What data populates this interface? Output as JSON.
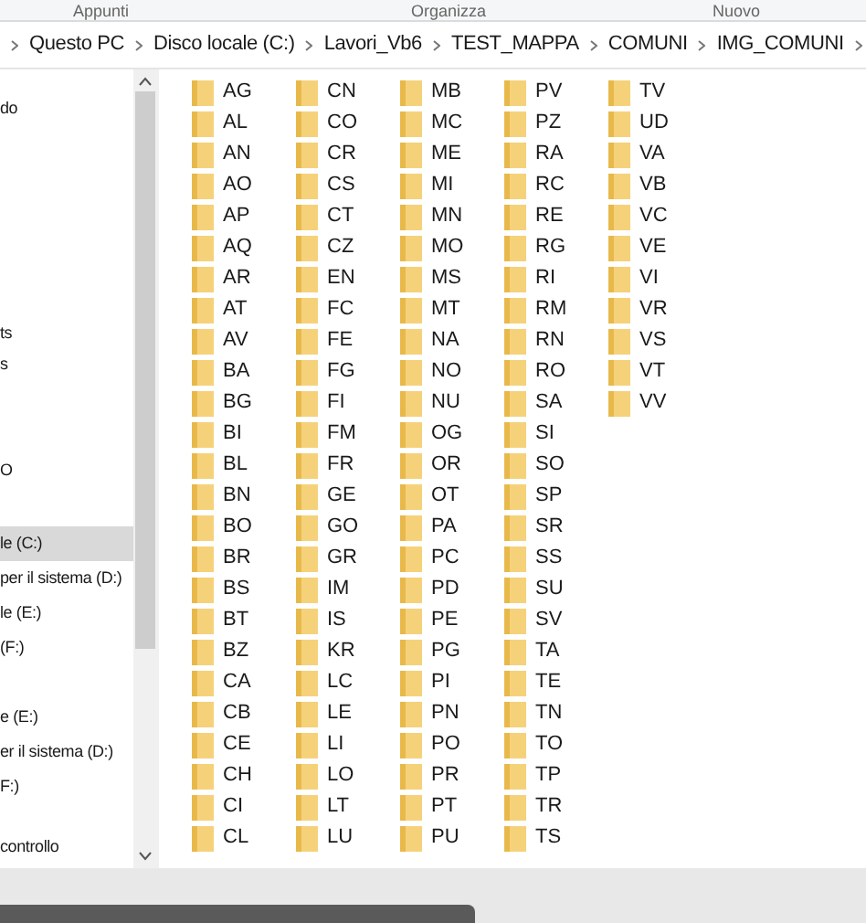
{
  "ribbon_groups": [
    "Appunti",
    "Organizza",
    "Nuovo"
  ],
  "breadcrumb": [
    "Questo PC",
    "Disco locale (C:)",
    "Lavori_Vb6",
    "TEST_MAPPA",
    "COMUNI",
    "IMG_COMUNI"
  ],
  "sidebar": {
    "items": [
      {
        "label": "do",
        "selected": false
      },
      {
        "label": "ts",
        "selected": false
      },
      {
        "label": "s",
        "selected": false
      },
      {
        "label": "O",
        "selected": false
      },
      {
        "label": "le (C:)",
        "selected": true
      },
      {
        "label": "per il sistema (D:)",
        "selected": false
      },
      {
        "label": "le (E:)",
        "selected": false
      },
      {
        "label": "(F:)",
        "selected": false
      },
      {
        "label": "e (E:)",
        "selected": false
      },
      {
        "label": "er il sistema (D:)",
        "selected": false
      },
      {
        "label": "F:)",
        "selected": false
      },
      {
        "label": "controllo",
        "selected": false
      }
    ]
  },
  "folders": [
    [
      "AG",
      "AL",
      "AN",
      "AO",
      "AP",
      "AQ",
      "AR",
      "AT",
      "AV",
      "BA",
      "BG",
      "BI",
      "BL",
      "BN",
      "BO",
      "BR",
      "BS",
      "BT",
      "BZ",
      "CA",
      "CB",
      "CE",
      "CH",
      "CI",
      "CL"
    ],
    [
      "CN",
      "CO",
      "CR",
      "CS",
      "CT",
      "CZ",
      "EN",
      "FC",
      "FE",
      "FG",
      "FI",
      "FM",
      "FR",
      "GE",
      "GO",
      "GR",
      "IM",
      "IS",
      "KR",
      "LC",
      "LE",
      "LI",
      "LO",
      "LT",
      "LU"
    ],
    [
      "MB",
      "MC",
      "ME",
      "MI",
      "MN",
      "MO",
      "MS",
      "MT",
      "NA",
      "NO",
      "NU",
      "OG",
      "OR",
      "OT",
      "PA",
      "PC",
      "PD",
      "PE",
      "PG",
      "PI",
      "PN",
      "PO",
      "PR",
      "PT",
      "PU"
    ],
    [
      "PV",
      "PZ",
      "RA",
      "RC",
      "RE",
      "RG",
      "RI",
      "RM",
      "RN",
      "RO",
      "SA",
      "SI",
      "SO",
      "SP",
      "SR",
      "SS",
      "SU",
      "SV",
      "TA",
      "TE",
      "TN",
      "TO",
      "TP",
      "TR",
      "TS"
    ],
    [
      "TV",
      "UD",
      "VA",
      "VB",
      "VC",
      "VE",
      "VI",
      "VR",
      "VS",
      "VT",
      "VV"
    ]
  ]
}
